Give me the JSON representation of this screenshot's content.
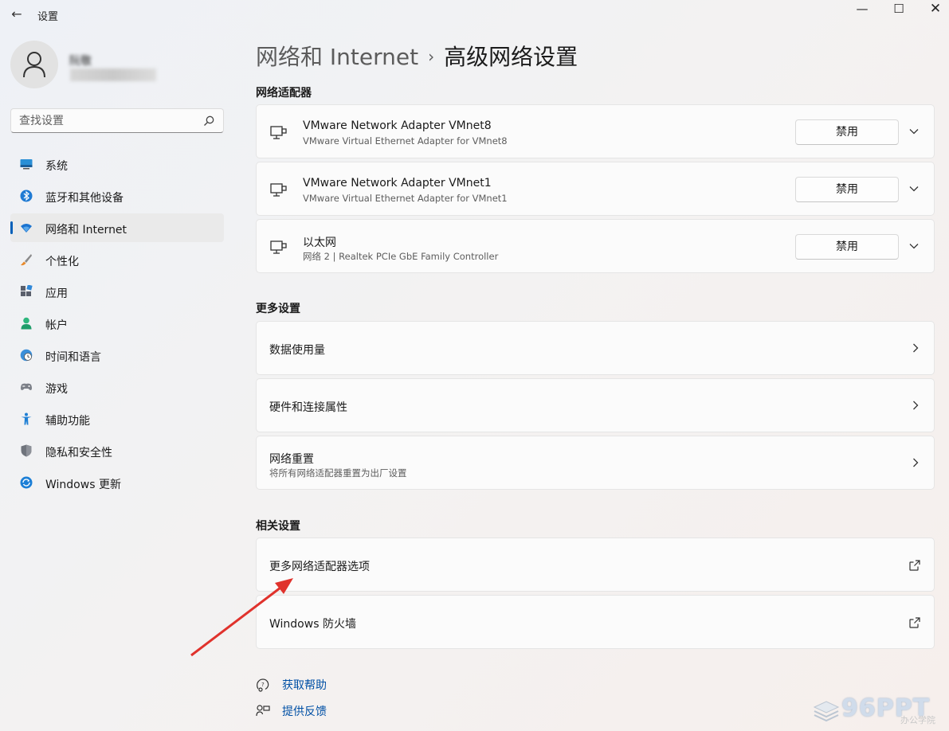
{
  "window": {
    "back_glyph": "←",
    "title": "设置",
    "minimize_glyph": "—",
    "maximize_glyph": "☐",
    "close_glyph": "✕"
  },
  "user": {
    "name": "阮敬"
  },
  "search": {
    "placeholder": "查找设置"
  },
  "sidebar": {
    "items": [
      {
        "label": "系统",
        "icon": "monitor-icon",
        "active": false
      },
      {
        "label": "蓝牙和其他设备",
        "icon": "bluetooth-icon",
        "active": false
      },
      {
        "label": "网络和 Internet",
        "icon": "wifi-icon",
        "active": true
      },
      {
        "label": "个性化",
        "icon": "brush-icon",
        "active": false
      },
      {
        "label": "应用",
        "icon": "apps-icon",
        "active": false
      },
      {
        "label": "帐户",
        "icon": "account-icon",
        "active": false
      },
      {
        "label": "时间和语言",
        "icon": "globe-clock-icon",
        "active": false
      },
      {
        "label": "游戏",
        "icon": "gamepad-icon",
        "active": false
      },
      {
        "label": "辅助功能",
        "icon": "accessibility-icon",
        "active": false
      },
      {
        "label": "隐私和安全性",
        "icon": "shield-icon",
        "active": false
      },
      {
        "label": "Windows 更新",
        "icon": "update-icon",
        "active": false
      }
    ]
  },
  "breadcrumb": {
    "parent": "网络和 Internet",
    "separator": "›",
    "current": "高级网络设置"
  },
  "adapters": {
    "section_title": "网络适配器",
    "items": [
      {
        "title": "VMware Network Adapter VMnet8",
        "subtitle": "VMware Virtual Ethernet Adapter for VMnet8",
        "button": "禁用"
      },
      {
        "title": "VMware Network Adapter VMnet1",
        "subtitle": "VMware Virtual Ethernet Adapter for VMnet1",
        "button": "禁用"
      },
      {
        "title": "以太网",
        "subtitle": "网络 2 | Realtek PCIe GbE Family Controller",
        "button": "禁用"
      }
    ]
  },
  "more_settings": {
    "section_title": "更多设置",
    "items": [
      {
        "title": "数据使用量"
      },
      {
        "title": "硬件和连接属性"
      },
      {
        "title": "网络重置",
        "subtitle": "将所有网络适配器重置为出厂设置"
      }
    ]
  },
  "related": {
    "section_title": "相关设置",
    "items": [
      {
        "title": "更多网络适配器选项"
      },
      {
        "title": "Windows 防火墙"
      }
    ]
  },
  "help": {
    "get_help": "获取帮助",
    "feedback": "提供反馈"
  },
  "watermark": {
    "text": "96PPT",
    "sub": "办公学院"
  },
  "colors": {
    "accent": "#005fb8",
    "link": "#0050a5",
    "annotation_arrow": "#e0322c"
  }
}
